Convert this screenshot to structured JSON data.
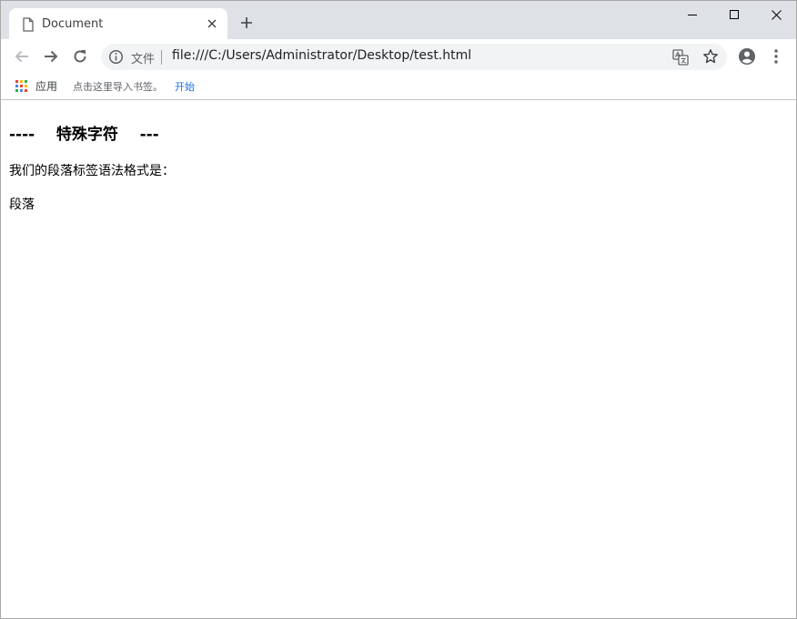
{
  "tab": {
    "title": "Document",
    "icon": "document-icon"
  },
  "toolbar": {
    "scheme_label": "文件",
    "url": "file:///C:/Users/Administrator/Desktop/test.html"
  },
  "bookmarks": {
    "apps_label": "应用",
    "hint": "点击这里导入书签。",
    "start_link": "开始"
  },
  "page": {
    "heading": "----    特殊字符    ---",
    "paragraphs": [
      "我们的段落标签语法格式是：",
      "段落"
    ]
  },
  "colors": {
    "tabstrip_bg": "#dee1e6",
    "omnibox_bg": "#f1f3f4",
    "link_blue": "#1a73e8",
    "apps_grid": [
      "#ea4335",
      "#fbbc05",
      "#34a853",
      "#4285f4"
    ]
  }
}
